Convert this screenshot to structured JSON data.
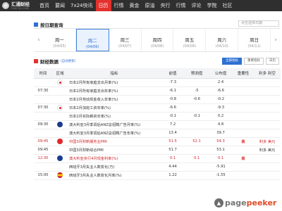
{
  "nav": {
    "logo_text": "汇通财经",
    "logo_sub": "FX678.COM",
    "items": [
      "首页",
      "要闻",
      "7x24快讯",
      "日历",
      "行情",
      "黄金",
      "原油",
      "央行",
      "行情",
      "评论",
      "学院",
      "社区"
    ]
  },
  "section": {
    "title": "按日期查询",
    "search_placeholder": "点击选择日期"
  },
  "week": {
    "prev": "‹",
    "next": "›",
    "days": [
      {
        "name": "周一",
        "date": "(04/05)"
      },
      {
        "name": "周二",
        "date": "(04/06)"
      },
      {
        "name": "周三",
        "date": "(04/07)"
      },
      {
        "name": "周四",
        "date": "(04/08)"
      },
      {
        "name": "周五",
        "date": "(04/09)"
      },
      {
        "name": "周六",
        "date": "(04/10)"
      },
      {
        "name": "周日",
        "date": "(04/11)"
      }
    ]
  },
  "data_section": {
    "title": "财经数据",
    "auto": "(自动更新)",
    "buttons": [
      "全部指标",
      "重要指标",
      "日历"
    ]
  },
  "table": {
    "headers": [
      "时间",
      "区域",
      "指标",
      "前值",
      "预测值",
      "公布值",
      "重要性",
      "利多 利空"
    ],
    "rows": [
      {
        "time": "",
        "flag": "jp",
        "name": "日本2月所有家庭支出月率(%)",
        "prev": "-7.3",
        "fore": "",
        "act": "2.4",
        "imp": "",
        "eff": "",
        "hl": false
      },
      {
        "time": "07:30",
        "flag": "",
        "name": "日本2月所有家庭支出年率(%)",
        "prev": "-6.1",
        "fore": "-5",
        "act": "-6.6",
        "imp": "",
        "eff": "",
        "hl": false
      },
      {
        "time": "",
        "flag": "",
        "name": "日本2月劳动现金收入年率(%)",
        "prev": "-0.8",
        "fore": "-0.6",
        "act": "-0.2",
        "imp": "",
        "eff": "",
        "hl": false
      },
      {
        "time": "07:30",
        "flag": "jp",
        "name": "日本2月加班工资年率(%)",
        "prev": "-6.6",
        "fore": "",
        "act": "-9.3",
        "imp": "",
        "eff": "",
        "hl": false
      },
      {
        "time": "",
        "flag": "",
        "name": "日本2月实际薪资年率(%)",
        "prev": "-0.1",
        "fore": "-0.1",
        "act": "0.2",
        "imp": "",
        "eff": "",
        "hl": false
      },
      {
        "time": "09:30",
        "flag": "au",
        "name": "澳大利亚3月季调后ANZ总招聘广告月率(%)",
        "prev": "7.2",
        "fore": "",
        "act": "4.8",
        "imp": "",
        "eff": "",
        "hl": false
      },
      {
        "time": "",
        "flag": "",
        "name": "澳大利亚3月季调后ANZ总招聘广告年率(%)",
        "prev": "13.4",
        "fore": "",
        "act": "39.7",
        "imp": "",
        "eff": "",
        "hl": false
      },
      {
        "time": "09:45",
        "flag": "cn",
        "name": "中国3月财新服务业PMI",
        "prev": "51.5",
        "fore": "52.1",
        "act": "54.3",
        "imp": "高",
        "eff": "利多 美元",
        "hl": true
      },
      {
        "time": "09:45",
        "flag": "",
        "name": "中国3月财新综合PMI",
        "prev": "51.7",
        "fore": "",
        "act": "53.1",
        "imp": "",
        "eff": "利多 美元",
        "hl": false
      },
      {
        "time": "12:30",
        "flag": "au",
        "name": "澳大利亚央行4月现金利率(%)",
        "prev": "0.1",
        "fore": "0.1",
        "act": "0.1",
        "imp": "高",
        "eff": "",
        "hl": true
      },
      {
        "time": "",
        "flag": "",
        "name": "西班牙3月失业人数变化(万)",
        "prev": "4.44",
        "fore": "",
        "act": "-5.91",
        "imp": "",
        "eff": "",
        "hl": false
      },
      {
        "time": "15:00",
        "flag": "es",
        "name": "西班牙3月失业人数变化月率(%)",
        "prev": "1.22",
        "fore": "",
        "act": "-1.55",
        "imp": "",
        "eff": "",
        "hl": false
      }
    ]
  },
  "watermark": {
    "prefix": "page",
    "suffix": "peeker"
  }
}
